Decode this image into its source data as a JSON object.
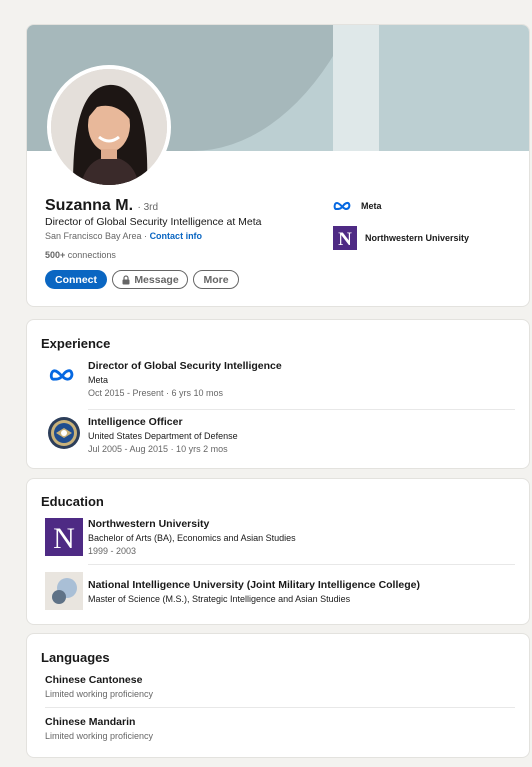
{
  "profile": {
    "name": "Suzanna M.",
    "degree": "· 3rd",
    "headline": "Director of Global Security Intelligence at Meta",
    "location": "San Francisco Bay Area ·",
    "contact_info": "Contact info",
    "connections_count": "500+",
    "connections_label": "connections",
    "buttons": {
      "connect": "Connect",
      "message": "Message",
      "more": "More"
    },
    "affiliations": [
      {
        "name": "Meta",
        "icon": "meta-logo-icon"
      },
      {
        "name": "Northwestern University",
        "icon": "northwestern-logo-icon"
      }
    ]
  },
  "experience": {
    "title": "Experience",
    "items": [
      {
        "title": "Director of Global Security Intelligence",
        "company": "Meta",
        "dates": "Oct 2015 - Present · 6 yrs 10 mos",
        "icon": "meta-logo-icon"
      },
      {
        "title": "Intelligence Officer",
        "company": "United States Department of Defense",
        "dates": "Jul 2005 - Aug 2015 · 10 yrs 2 mos",
        "icon": "dod-seal-icon"
      }
    ]
  },
  "education": {
    "title": "Education",
    "items": [
      {
        "school": "Northwestern University",
        "degree": "Bachelor of Arts (BA), Economics and Asian Studies",
        "dates": "1999 - 2003",
        "icon": "northwestern-logo-icon"
      },
      {
        "school": "National Intelligence University (Joint Military Intelligence College)",
        "degree": "Master of Science (M.S.), Strategic Intelligence and Asian Studies",
        "icon": "school-placeholder-icon"
      }
    ]
  },
  "languages": {
    "title": "Languages",
    "items": [
      {
        "name": "Chinese Cantonese",
        "proficiency": "Limited working proficiency"
      },
      {
        "name": "Chinese Mandarin",
        "proficiency": "Limited working proficiency"
      }
    ]
  },
  "colors": {
    "brand_blue": "#0a66c2",
    "northwestern_purple": "#4e2a84",
    "meta_blue": "#0668e1"
  }
}
